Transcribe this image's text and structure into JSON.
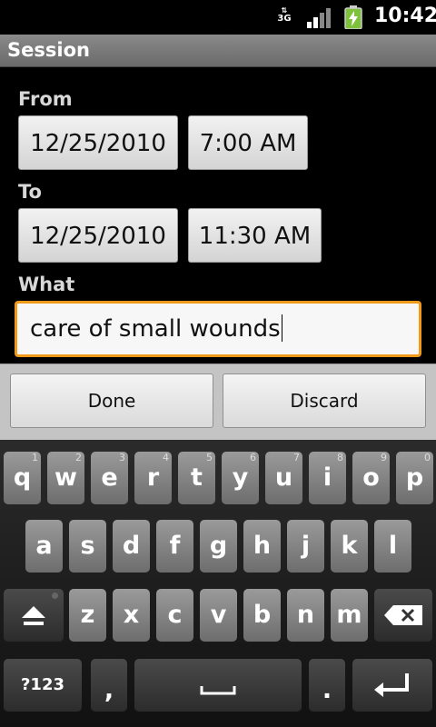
{
  "status_bar": {
    "network": "3G",
    "time": "10:42"
  },
  "title_bar": {
    "title": "Session"
  },
  "form": {
    "from_label": "From",
    "from_date": "12/25/2010",
    "from_time": "7:00 AM",
    "to_label": "To",
    "to_date": "12/25/2010",
    "to_time": "11:30 AM",
    "what_label": "What",
    "what_value": "care of small wounds"
  },
  "actions": {
    "done": "Done",
    "discard": "Discard"
  },
  "keyboard": {
    "row1": [
      {
        "k": "q",
        "h": "1"
      },
      {
        "k": "w",
        "h": "2"
      },
      {
        "k": "e",
        "h": "3"
      },
      {
        "k": "r",
        "h": "4"
      },
      {
        "k": "t",
        "h": "5"
      },
      {
        "k": "y",
        "h": "6"
      },
      {
        "k": "u",
        "h": "7"
      },
      {
        "k": "i",
        "h": "8"
      },
      {
        "k": "o",
        "h": "9"
      },
      {
        "k": "p",
        "h": "0"
      }
    ],
    "row2": [
      "a",
      "s",
      "d",
      "f",
      "g",
      "h",
      "j",
      "k",
      "l"
    ],
    "row3": [
      "z",
      "x",
      "c",
      "v",
      "b",
      "n",
      "m"
    ],
    "symbols_key": "?123",
    "comma_key": ",",
    "period_key": "."
  },
  "colors": {
    "focus_border": "#f19a1a"
  }
}
